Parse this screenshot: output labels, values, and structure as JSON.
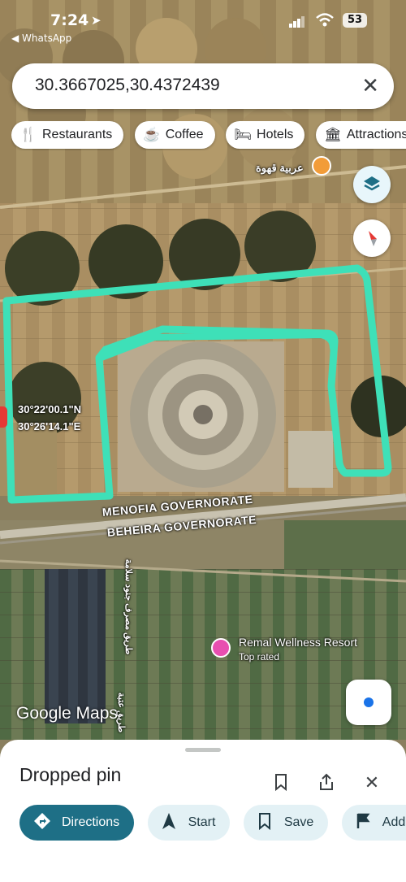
{
  "status_bar": {
    "time": "7:24",
    "back_label": "◀ WhatsApp",
    "battery": "53"
  },
  "search": {
    "query": "30.3667025,30.4372439"
  },
  "chips": [
    {
      "label": "Restaurants",
      "icon": "fork-knife-icon"
    },
    {
      "label": "Coffee",
      "icon": "coffee-cup-icon"
    },
    {
      "label": "Hotels",
      "icon": "bed-icon"
    },
    {
      "label": "Attractions",
      "icon": "attraction-icon"
    }
  ],
  "map": {
    "poi_arabic": "عربية قهوة",
    "pin_coords": {
      "lat": "30°22'00.1\"N",
      "lon": "30°26'14.1\"E"
    },
    "region_top": "MENOFIA GOVERNORATE",
    "region_bottom": "BEHEIRA GOVERNORATE",
    "road_arabic_left": "طريق مصرف جنود سلامة",
    "road_arabic_bottom": "طريق عتبة",
    "resort": {
      "name": "Remal Wellness Resort",
      "note": "Top rated"
    },
    "attribution": "Google Maps",
    "highlight_color": "#3ee0b8"
  },
  "sheet": {
    "title": "Dropped pin",
    "buttons": [
      {
        "label": "Directions",
        "icon": "directions-icon"
      },
      {
        "label": "Start",
        "icon": "navigation-arrow-icon"
      },
      {
        "label": "Save",
        "icon": "bookmark-icon"
      },
      {
        "label": "Add l",
        "icon": "flag-icon"
      }
    ]
  }
}
